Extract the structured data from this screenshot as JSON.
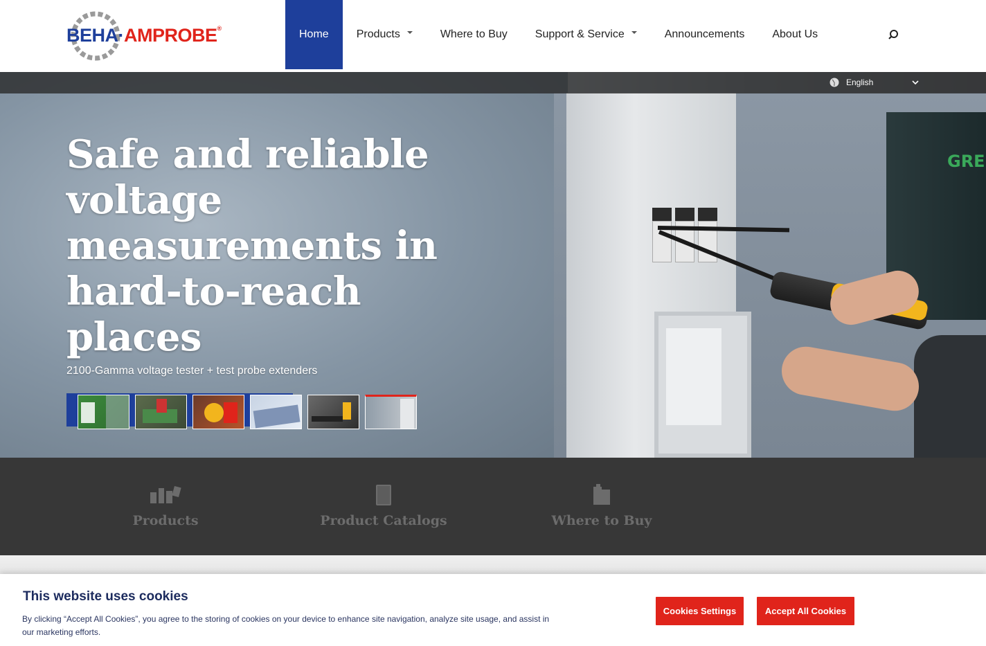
{
  "header": {
    "logo": {
      "brand_left": "BEHA",
      "separator": "·",
      "brand_right": "AMPROBE",
      "registered": "®"
    },
    "nav": [
      {
        "label": "Home",
        "active": true,
        "dropdown": false
      },
      {
        "label": "Products",
        "active": false,
        "dropdown": true
      },
      {
        "label": "Where to Buy",
        "active": false,
        "dropdown": false
      },
      {
        "label": "Support & Service",
        "active": false,
        "dropdown": true
      },
      {
        "label": "Announcements",
        "active": false,
        "dropdown": false
      },
      {
        "label": "About Us",
        "active": false,
        "dropdown": false
      }
    ],
    "search_icon": "search-icon"
  },
  "language": {
    "current": "English",
    "icon": "globe-icon"
  },
  "hero": {
    "title": "Safe and reliable voltage measurements in hard-to-reach places",
    "subtitle": "2100-Gamma voltage tester + test probe extenders",
    "cabinet_text": "GREENR",
    "thumbnails": 6,
    "active_thumbnail": 6
  },
  "quick_links": [
    {
      "label": "Products",
      "icon": "products-icon"
    },
    {
      "label": "Product Catalogs",
      "icon": "catalog-icon"
    },
    {
      "label": "Where to Buy",
      "icon": "where-to-buy-icon"
    }
  ],
  "cookie_banner": {
    "title": "This website uses cookies",
    "text": "By clicking “Accept All Cookies”, you agree to the storing of cookies on your device to enhance site navigation, analyze site usage, and assist in our marketing efforts.",
    "settings_label": "Cookies Settings",
    "accept_label": "Accept All Cookies"
  },
  "colors": {
    "brand_blue": "#1e3f9b",
    "brand_red": "#e0241b",
    "band_dark": "#373737"
  }
}
